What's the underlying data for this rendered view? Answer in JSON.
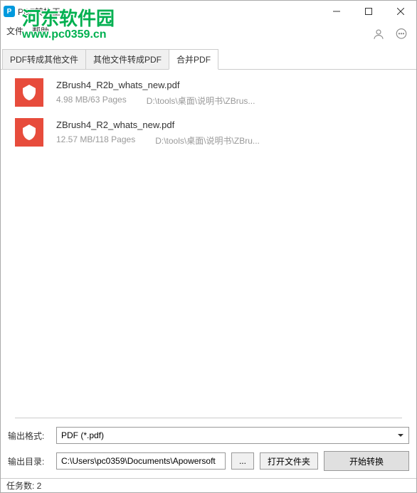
{
  "window": {
    "title": "PDF转换王"
  },
  "menu": {
    "file": "文件",
    "help": "帮助"
  },
  "watermark": {
    "line1": "河东软件园",
    "line2": "www.pc0359.cn"
  },
  "tabs": {
    "tab1": "PDF转成其他文件",
    "tab2": "其他文件转成PDF",
    "tab3": "合并PDF"
  },
  "files": [
    {
      "name": "ZBrush4_R2b_whats_new.pdf",
      "size": "4.98 MB/63 Pages",
      "path": "D:\\tools\\桌面\\说明书\\ZBrus..."
    },
    {
      "name": "ZBrush4_R2_whats_new.pdf",
      "size": "12.57 MB/118 Pages",
      "path": "D:\\tools\\桌面\\说明书\\ZBru..."
    }
  ],
  "output": {
    "format_label": "输出格式:",
    "format_value": "PDF (*.pdf)",
    "dir_label": "输出目录:",
    "dir_value": "C:\\Users\\pc0359\\Documents\\Apowersoft",
    "browse": "...",
    "open_folder": "打开文件夹",
    "start": "开始转换"
  },
  "status": {
    "tasks": "任务数: 2"
  }
}
